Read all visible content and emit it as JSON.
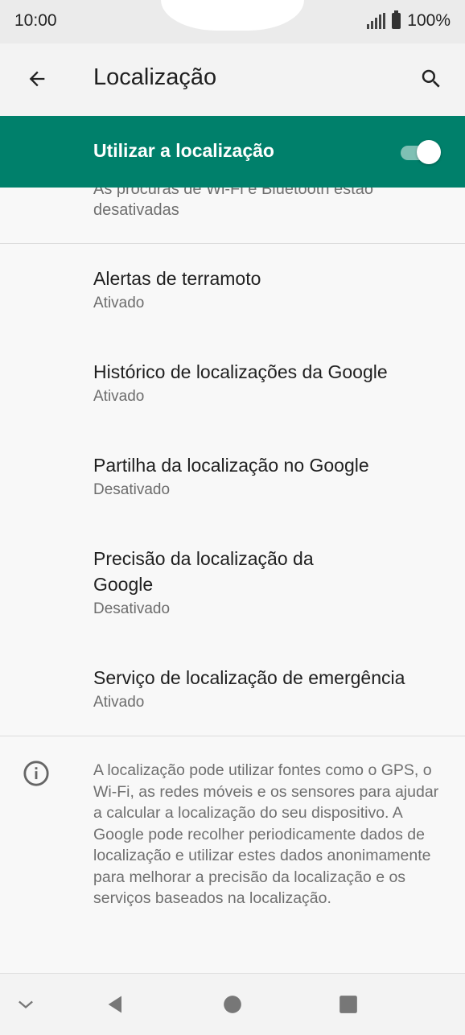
{
  "status_bar": {
    "time": "10:00",
    "battery": "100%"
  },
  "app_bar": {
    "title": "Localização"
  },
  "master_switch": {
    "label": "Utilizar a localização",
    "on": true
  },
  "scrolled_text": "As procuras de Wi-Fi e Bluetooth estão desativadas",
  "items": [
    {
      "title": "Alertas de terramoto",
      "subtitle": "Ativado"
    },
    {
      "title": "Histórico de localizações da Google",
      "subtitle": "Ativado"
    },
    {
      "title": "Partilha da localização no Google",
      "subtitle": "Desativado"
    },
    {
      "title": "Precisão da localização da Google",
      "subtitle": "Desativado"
    },
    {
      "title": "Serviço de localização de emergência",
      "subtitle": "Ativado"
    }
  ],
  "info": "A localização pode utilizar fontes como o GPS, o Wi-Fi, as redes móveis e os sensores para ajudar a calcular a localização do seu dispositivo. A Google pode recolher periodicamente dados de localização e utilizar estes dados anonimamente para melhorar a precisão da localização e os serviços baseados na localização.",
  "colors": {
    "accent": "#00806b",
    "background": "#f8f8f8"
  },
  "icons": {
    "back": "arrow-left-icon",
    "search": "search-icon",
    "info": "info-icon",
    "nav_down": "chevron-down-icon",
    "nav_back": "triangle-back-icon",
    "nav_home": "circle-home-icon",
    "nav_recents": "square-recents-icon"
  }
}
